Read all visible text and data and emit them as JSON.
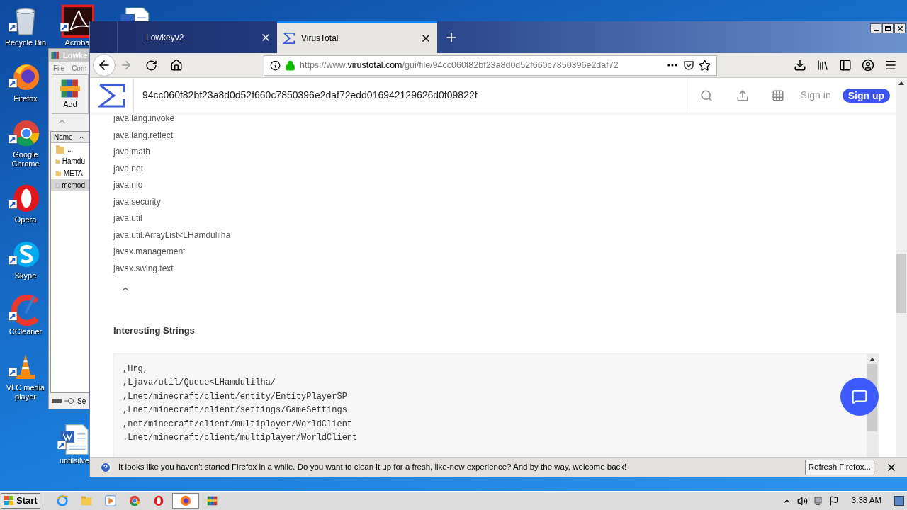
{
  "desktop_icons": [
    {
      "label": "Recycle Bin",
      "kind": "recycle"
    },
    {
      "label": "Firefox",
      "kind": "firefox"
    },
    {
      "label": "Google Chrome",
      "kind": "chrome"
    },
    {
      "label": "Opera",
      "kind": "opera"
    },
    {
      "label": "Skype",
      "kind": "skype"
    },
    {
      "label": "CCleaner",
      "kind": "ccleaner"
    },
    {
      "label": "VLC media player",
      "kind": "vlc"
    }
  ],
  "desktop_icons_2": [
    {
      "label": "Acroba",
      "kind": "pdf"
    },
    {
      "label": "untilsilve",
      "kind": "word"
    }
  ],
  "archive_window": {
    "title": "Lowke",
    "menu": [
      "File",
      "Com"
    ],
    "tool": "Add",
    "column": "Name",
    "status": "Se",
    "files": [
      {
        "name": "..",
        "kind": "folder",
        "selected": false
      },
      {
        "name": "Hamdu",
        "kind": "folder",
        "selected": false
      },
      {
        "name": "META-",
        "kind": "folder",
        "selected": false
      },
      {
        "name": "mcmod",
        "kind": "file",
        "selected": true
      }
    ]
  },
  "browser": {
    "tabs": [
      {
        "title": "Lowkeyv2",
        "selected": false
      },
      {
        "title": "VirusTotal",
        "selected": true
      }
    ],
    "url": {
      "scheme": "https://www.",
      "host": "virustotal.com",
      "path": "/gui/file/94cc060f82bf23a8d0d52f660c7850396e2daf72"
    },
    "page": {
      "search": "94cc060f82bf23a8d0d52f660c7850396e2daf72edd016942129626d0f09822f",
      "sign_in": "Sign in",
      "sign_up": "Sign up",
      "imports": [
        "java.lang.invoke",
        "java.lang.reflect",
        "java.math",
        "java.net",
        "java.nio",
        "java.security",
        "java.util",
        "java.util.ArrayList<LHamdulilha",
        "javax.management",
        "javax.swing.text"
      ],
      "section_title": "Interesting Strings",
      "strings": [
        ",Hrg,",
        ",Ljava/util/Queue<LHamdulilha/",
        ",Lnet/minecraft/client/entity/EntityPlayerSP",
        ",Lnet/minecraft/client/settings/GameSettings",
        ",net/minecraft/client/multiplayer/WorldClient",
        ".Lnet/minecraft/client/multiplayer/WorldClient"
      ]
    },
    "notification": {
      "message": "It looks like you haven't started Firefox in a while. Do you want to clean it up for a fresh, like-new experience? And by the way, welcome back!",
      "button": "Refresh Firefox..."
    }
  },
  "taskbar": {
    "start": "Start",
    "apps": [
      {
        "kind": "ie",
        "selected": false
      },
      {
        "kind": "explorer",
        "selected": false
      },
      {
        "kind": "media",
        "selected": false
      },
      {
        "kind": "chrome",
        "selected": false
      },
      {
        "kind": "opera",
        "selected": false
      },
      {
        "kind": "firefox",
        "selected": true
      },
      {
        "kind": "winrar",
        "selected": false
      }
    ],
    "time": "3:38 AM"
  }
}
